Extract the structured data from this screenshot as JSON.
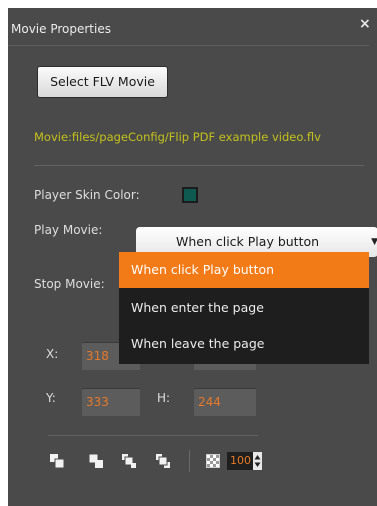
{
  "panel": {
    "title": "Movie Properties",
    "close_glyph": "×"
  },
  "select_button": {
    "label": "Select FLV Movie"
  },
  "movie_path": "Movie:files/pageConfig/Flip PDF example video.flv",
  "player_skin": {
    "label": "Player Skin Color:",
    "color": "#0f5a50"
  },
  "play_movie": {
    "label": "Play Movie:",
    "selected": "When click Play button",
    "arrow_glyph": "▼"
  },
  "stop_movie": {
    "label": "Stop Movie:"
  },
  "dropdown": {
    "options": [
      "When click Play button",
      "When enter the page",
      "When leave the page"
    ],
    "highlight_color": "#f27a17"
  },
  "position": {
    "x_label": "X:",
    "x_value": "318",
    "y_label": "Y:",
    "y_value": "333",
    "h_label": "H:",
    "h_value": "244"
  },
  "toolbar": {
    "icons": [
      "bring-to-front-icon",
      "send-to-back-icon",
      "bring-forward-icon",
      "send-backward-icon"
    ],
    "alpha_icon": "transparency-checker-icon",
    "alpha_value": "100"
  },
  "colors": {
    "panel_bg": "#4a4a4a",
    "path_text": "#c3c21c",
    "value_text": "#e6792a"
  }
}
